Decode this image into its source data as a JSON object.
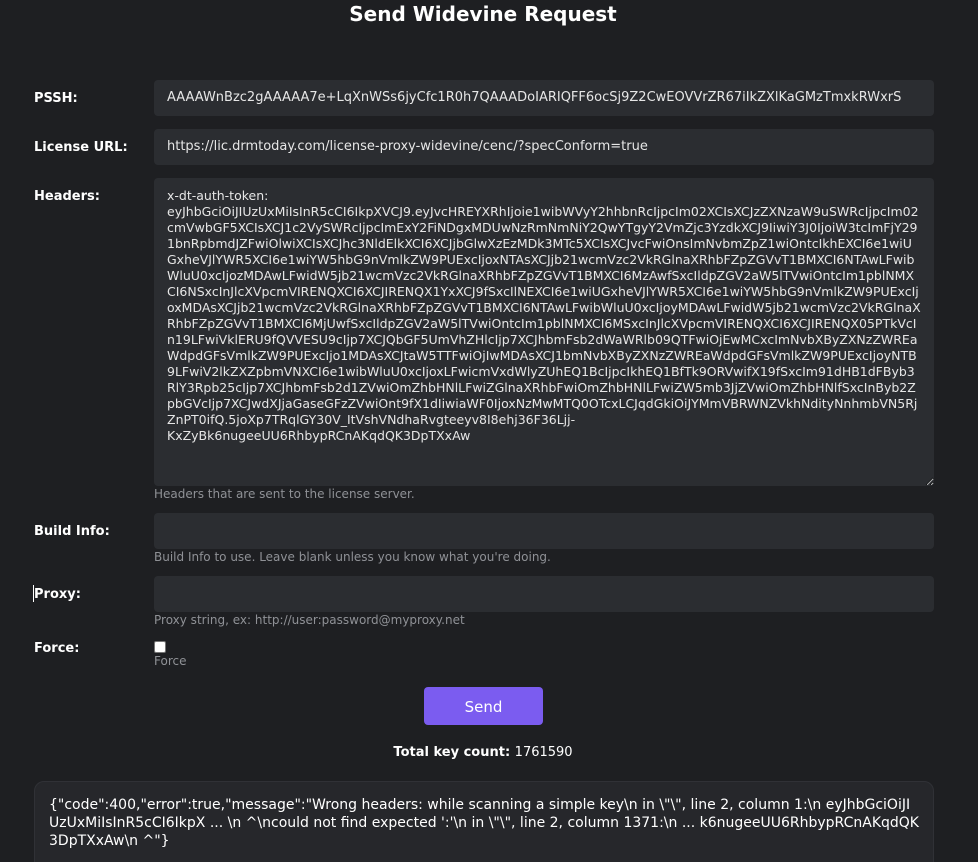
{
  "title": "Send Widevine Request",
  "pssh": {
    "label": "PSSH:",
    "value": "AAAAWnBzc2gAAAAA7e+LqXnWSs6jyCfc1R0h7QAAADoIARIQFF6ocSj9Z2CwEOVVrZR67iIkZXlKaGMzTmxkRWxrS"
  },
  "license_url": {
    "label": "License URL:",
    "value": "https://lic.drmtoday.com/license-proxy-widevine/cenc/?specConform=true"
  },
  "headers": {
    "label": "Headers:",
    "value": "x-dt-auth-token:\neyJhbGciOiJIUzUxMiIsInR5cCI6IkpXVCJ9.eyJvcHREYXRhIjoie1wibWVyY2hhbnRcIjpcIm02XCIsXCJzZXNzaW9uSWRcIjpcIm02cmVwbGF5XCIsXCJ1c2VySWRcIjpcImExY2FiNDgxMDUwNzRmNmNiY2QwYTgyY2VmZjc3YzdkXCJ9IiwiY3J0IjoiW3tcImFjY291bnRpbmdJZFwiOlwiXCIsXCJhc3NldElkXCI6XCJjbGlwXzEzMDk3MTc5XCIsXCJvcFwiOnsImNvbmZpZ1wiOntcIkhEXCI6e1wiUGxheVJlYWR5XCI6e1wiYW5hbG9nVmlkZW9PUExcIjoxNTAsXCJjb21wcmVzc2VkRGlnaXRhbFZpZGVvT1BMXCI6NTAwLFwibWluU0xcIjozMDAwLFwidW5jb21wcmVzc2VkRGlnaXRhbFZpZGVvT1BMXCI6MzAwfSxcIldpZGV2aW5lTVwiOntcIm1pblNMXCI6NSxcInJlcXVpcmVIRENQXCI6XCJIRENQX1YxXCJ9fSxcIlNEXCI6e1wiUGxheVJlYWR5XCI6e1wiYW5hbG9nVmlkZW9PUExcIjoxMDAsXCJjb21wcmVzc2VkRGlnaXRhbFZpZGVvT1BMXCI6NTAwLFwibWluU0xcIjoyMDAwLFwidW5jb21wcmVzc2VkRGlnaXRhbFZpZGVvT1BMXCI6MjUwfSxcIldpZGV2aW5lTVwiOntcIm1pblNMXCI6MSxcInJlcXVpcmVIRENQXCI6XCJIRENQX05PTkVcIn19LFwiVklERU9fQVVESU9cIjp7XCJQbGF5UmVhZHlcIjp7XCJhbmFsb2dWaWRlb09QTFwiOjEwMCxcImNvbXByZXNzZWREaWdpdGFsVmlkZW9PUExcIjo1MDAsXCJtaW5TTFwiOjIwMDAsXCJ1bmNvbXByZXNzZWREaWdpdGFsVmlkZW9PUExcIjoyNTB9LFwiV2lkZXZpbmVNXCI6e1wibWluU0xcIjoxLFwicmVxdWlyZUhEQ1BcIjpcIkhEQ1BfTk9ORVwifX19fSxcIm91dHB1dFByb3RlY3Rpb25cIjp7XCJhbmFsb2d1ZVwiOmZhbHNlLFwiZGlnaXRhbFwiOmZhbHNlLFwiZW5mb3JjZVwiOmZhbHNlfSxcInByb2ZpbGVcIjp7XCJwdXJjaGaseGFzZVwiOnt9fX1dIiwiaWF0IjoxNzMwMTQ0OTcxLCJqdGkiOiJYMmVBRWNZVkhNdityNnhmbVN5RjZnPT0ifQ.5joXp7TRqlGY30V_ItVshVNdhaRvgteeyv8I8ehj36F36Ljj-\nKxZyBk6nugeeUU6RhbypRCnAKqdQK3DpTXxAw",
    "help": "Headers that are sent to the license server."
  },
  "build_info": {
    "label": "Build Info:",
    "value": "",
    "help": "Build Info to use. Leave blank unless you know what you're doing."
  },
  "proxy": {
    "label": "Proxy:",
    "value": "",
    "help": "Proxy string, ex: http://user:password@myproxy.net"
  },
  "force": {
    "label": "Force:",
    "checked": false,
    "help": "Force"
  },
  "send_button": "Send",
  "key_count": {
    "label": "Total key count:",
    "value": "1761590"
  },
  "response": "{\"code\":400,\"error\":true,\"message\":\"Wrong headers: while scanning a simple key\\n in \\\"\\\", line 2, column 1:\\n eyJhbGciOiJIUzUxMiIsInR5cCI6IkpX ... \\n ^\\ncould not find expected ':'\\n in \\\"\\\", line 2, column 1371:\\n ... k6nugeeUU6RhbypRCnAKqdQK3DpTXxAw\\n ^\"}"
}
